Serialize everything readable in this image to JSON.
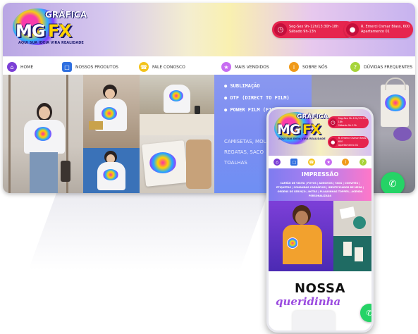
{
  "logo": {
    "brand_top": "GRÁFICA",
    "brand_left": "MG",
    "brand_right": "FX",
    "tagline": "AQUI SUA IDEIA VIRA REALIDADE"
  },
  "header": {
    "hours_line1": "Seg-Sex 9h-12h/13:30h-18h",
    "hours_line2": "Sábado 9h-13h",
    "address_line1": "R. Emerci Osmar Blass, 600",
    "address_line2": "Apartamento 01"
  },
  "nav": {
    "items": [
      {
        "label": "HOME",
        "icon": "home-icon",
        "color": "#7b3fd6"
      },
      {
        "label": "NOSSOS PRODUTOS",
        "icon": "box-icon",
        "color": "#2f6fe0"
      },
      {
        "label": "FALE CONOSCO",
        "icon": "phone-icon",
        "color": "#f3c31b"
      },
      {
        "label": "MAIS VENDIDOS",
        "icon": "star-icon",
        "color": "#c86df2"
      },
      {
        "label": "SOBRE NÓS",
        "icon": "info-icon",
        "color": "#f09a1a"
      },
      {
        "label": "DÚVIDAS FREQUENTES",
        "icon": "help-icon",
        "color": "#a7d43a"
      }
    ]
  },
  "hero": {
    "services": [
      "SUBLIMAÇÃO",
      "DTF (DIRECT TO FILM)",
      "POWER FILM (FILME DE RECORTE)"
    ],
    "copy_lines": [
      "CAMISETAS, MOL",
      "REGATAS, SACO",
      "TOALHAS"
    ]
  },
  "mobile": {
    "band_title": "IMPRESSÃO",
    "band_text": "CARTÃO DE VISITA | FOTOS | ADESIVOS | TAGS | CONVITES | ETIQUETAS | COMANDAS CARDÁPIOS | IDENTIFICADOR DE MESA | ORDENS DE SERVIÇO | NOTAS | PLAQUINHAS TOPPER | AGENDA PERSONALIZADA",
    "section_title": "NOSSA",
    "section_subtitle": "queridinha"
  },
  "colors": {
    "accent": "#e6254e",
    "panel": "#7d8ef2",
    "whatsapp": "#25d366"
  }
}
